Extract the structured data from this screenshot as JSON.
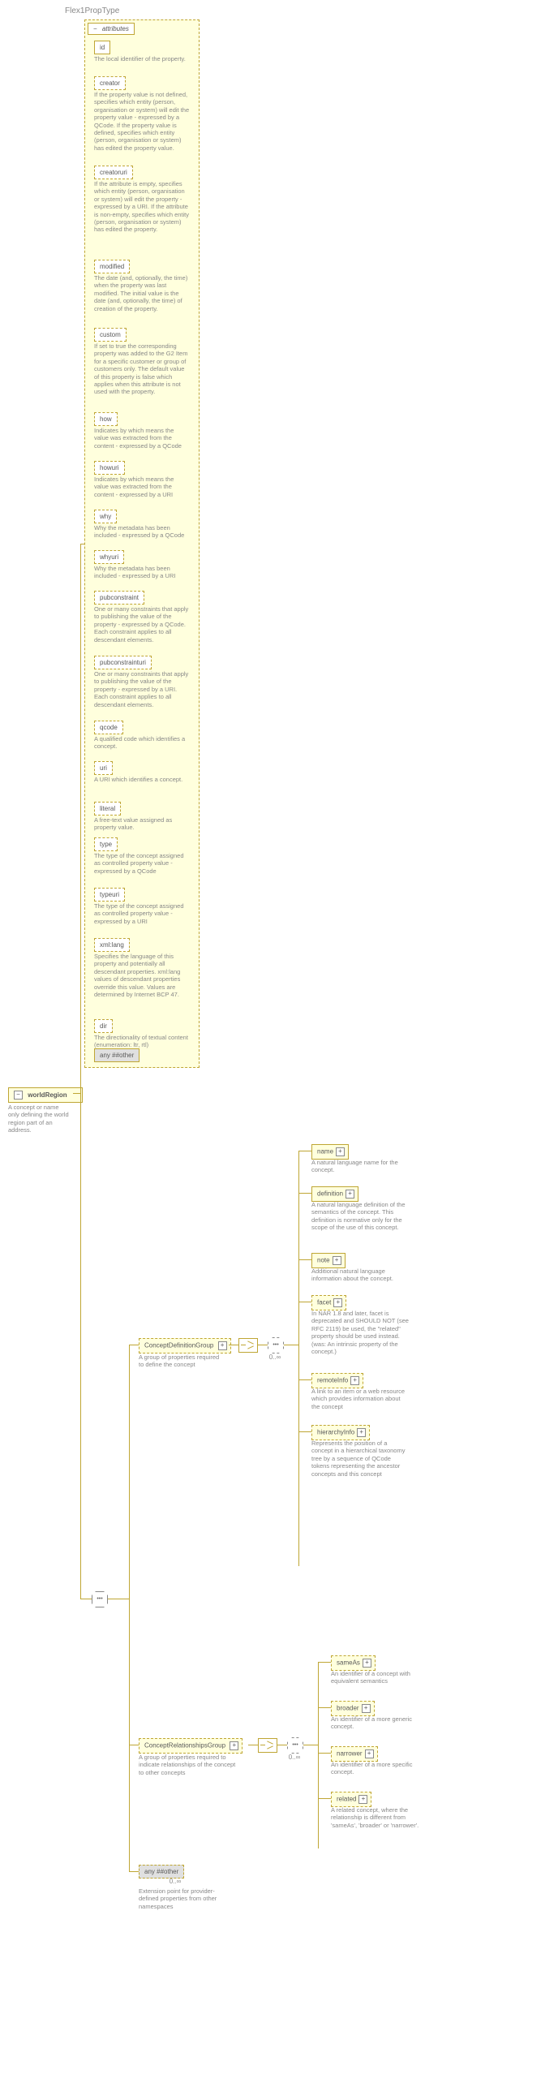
{
  "title": "Flex1PropType",
  "root": {
    "label": "worldRegion",
    "desc": "A concept or name only defining the world region part of an address."
  },
  "attrHeader": "attributes",
  "attrs": [
    {
      "name": "id",
      "desc": "The local identifier of the property."
    },
    {
      "name": "creator",
      "desc": "If the property value is not defined, specifies which entity (person, organisation or system) will edit the property value - expressed by a QCode. If the property value is defined, specifies which entity (person, organisation or system) has edited the property value.",
      "dashed": true
    },
    {
      "name": "creatoruri",
      "desc": "If the attribute is empty, specifies which entity (person, organisation or system) will edit the property - expressed by a URI. If the attribute is non-empty, specifies which entity (person, organisation or system) has edited the property.",
      "dashed": true
    },
    {
      "name": "modified",
      "desc": "The date (and, optionally, the time) when the property was last modified. The initial value is the date (and, optionally, the time) of creation of the property.",
      "dashed": true
    },
    {
      "name": "custom",
      "desc": "If set to true the corresponding property was added to the G2 Item for a specific customer or group of customers only. The default value of this property is false which applies when this attribute is not used with the property.",
      "dashed": true
    },
    {
      "name": "how",
      "desc": "Indicates by which means the value was extracted from the content - expressed by a QCode",
      "dashed": true
    },
    {
      "name": "howuri",
      "desc": "Indicates by which means the value was extracted from the content - expressed by a URI",
      "dashed": true
    },
    {
      "name": "why",
      "desc": "Why the metadata has been included - expressed by a QCode",
      "dashed": true
    },
    {
      "name": "whyuri",
      "desc": "Why the metadata has been included - expressed by a URI",
      "dashed": true
    },
    {
      "name": "pubconstraint",
      "desc": "One or many constraints that apply to publishing the value of the property - expressed by a QCode. Each constraint applies to all descendant elements.",
      "dashed": true
    },
    {
      "name": "pubconstrainturi",
      "desc": "One or many constraints that apply to publishing the value of the property - expressed by a URI. Each constraint applies to all descendant elements.",
      "dashed": true
    },
    {
      "name": "qcode",
      "desc": "A qualified code which identifies a concept.",
      "dashed": true
    },
    {
      "name": "uri",
      "desc": "A URI which identifies a concept.",
      "dashed": true
    },
    {
      "name": "literal",
      "desc": "A free-text value assigned as property value.",
      "dashed": true
    },
    {
      "name": "type",
      "desc": "The type of the concept assigned as controlled property value - expressed by a QCode",
      "dashed": true
    },
    {
      "name": "typeuri",
      "desc": "The type of the concept assigned as controlled property value - expressed by a URI",
      "dashed": true
    },
    {
      "name": "xml:lang",
      "desc": "Specifies the language of this property and potentially all descendant properties. xml:lang values of descendant properties override this value. Values are determined by Internet BCP 47.",
      "dashed": true
    },
    {
      "name": "dir",
      "desc": "The directionality of textual content (enumeration: ltr, rtl)",
      "dashed": true
    }
  ],
  "anyOther": "any ##other",
  "anyOtherDesc": "Extension point for provider-defined properties from other namespaces",
  "groups": [
    {
      "name": "ConceptDefinitionGroup",
      "desc": "A group of properties required to define the concept"
    },
    {
      "name": "ConceptRelationshipsGroup",
      "desc": "A group of properties required to indicate relationships of the concept to other concepts"
    }
  ],
  "defChildren": [
    {
      "name": "name",
      "desc": "A natural language name for the concept."
    },
    {
      "name": "definition",
      "desc": "A natural language definition of the semantics of the concept. This definition is normative only for the scope of the use of this concept."
    },
    {
      "name": "note",
      "desc": "Additional natural language information about the concept."
    },
    {
      "name": "facet",
      "desc": "In NAR 1.8 and later, facet is deprecated and SHOULD NOT (see RFC 2119) be used, the \"related\" property should be used instead.(was: An intrinsic property of the concept.)",
      "dashed": true
    },
    {
      "name": "remoteInfo",
      "desc": "A link to an item or a web resource which provides information about the concept",
      "dashed": true
    },
    {
      "name": "hierarchyInfo",
      "desc": "Represents the position of a concept in a hierarchical taxonomy tree by a sequence of QCode tokens representing the ancestor concepts and this concept",
      "dashed": true
    }
  ],
  "relChildren": [
    {
      "name": "sameAs",
      "desc": "An identifier of a concept with equivalent semantics",
      "dashed": true
    },
    {
      "name": "broader",
      "desc": "An identifier of a more generic concept.",
      "dashed": true
    },
    {
      "name": "narrower",
      "desc": "An identifier of a more specific concept.",
      "dashed": true
    },
    {
      "name": "related",
      "desc": "A related concept, where the relationship is different from 'sameAs', 'broader' or 'narrower'.",
      "dashed": true
    }
  ],
  "card": "0..∞"
}
